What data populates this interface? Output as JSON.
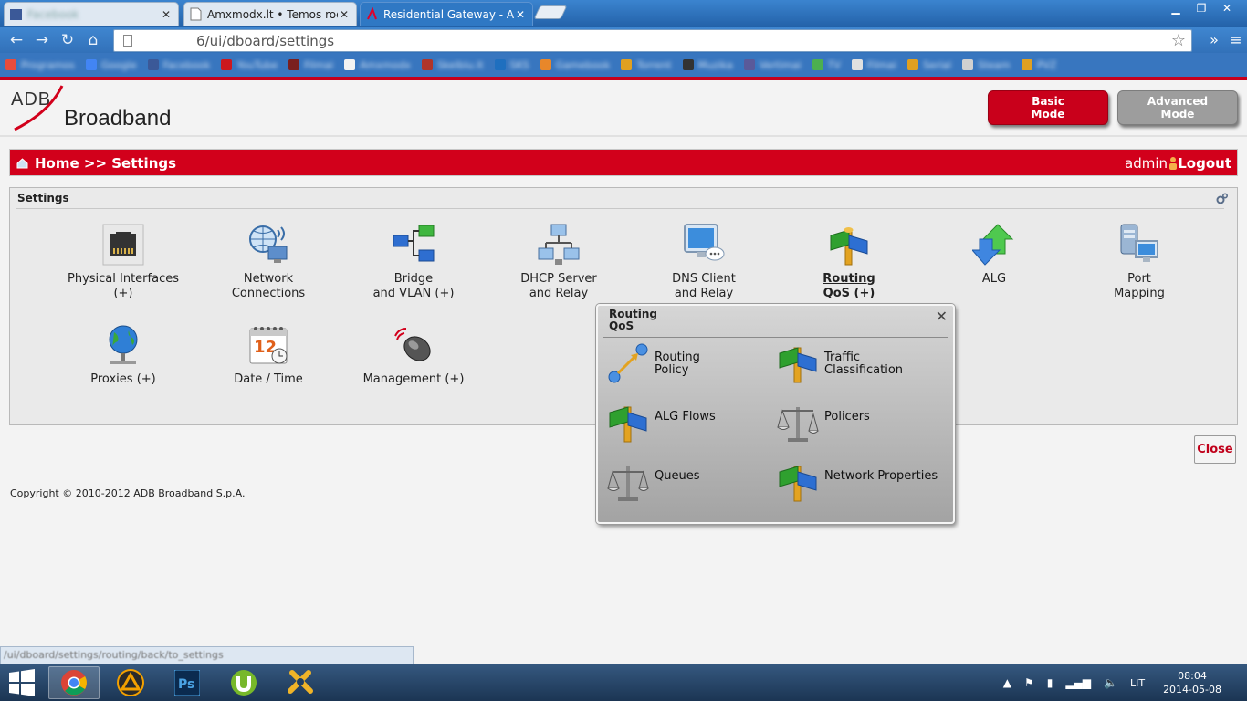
{
  "browser": {
    "tabs": [
      {
        "title": "Facebook",
        "blurred": true
      },
      {
        "title": "Amxmodx.lt • Temos rody",
        "blurred": false
      },
      {
        "title": "Residential Gateway - ADB",
        "blurred": false
      }
    ],
    "url": "6/ui/dboard/settings",
    "status_url": "/ui/dboard/settings/routing/back/to_settings",
    "bookmarks": [
      "Programos",
      "Google",
      "Facebook",
      "YouTube",
      "Filmai",
      "Amxmodx",
      "Skelbiu.lt",
      "SKS",
      "Gamebook",
      "Torrent",
      "Muzika",
      "Vertimai",
      "TV",
      "Filmai",
      "Serial",
      "Steam",
      "PVZ"
    ]
  },
  "header": {
    "logo_adb": "ADB",
    "logo_broadband": "Broadband",
    "basic_mode_line1": "Basic",
    "basic_mode_line2": "Mode",
    "advanced_mode_line1": "Advanced",
    "advanced_mode_line2": "Mode"
  },
  "crumbbar": {
    "path": "Home >> Settings",
    "user": "admin",
    "logout": "Logout"
  },
  "settings": {
    "title": "Settings",
    "items": [
      {
        "line1": "Physical Interfaces",
        "line2": "(+)",
        "icon": "ethernet-port-icon"
      },
      {
        "line1": "Network",
        "line2": "Connections",
        "icon": "globe-network-icon"
      },
      {
        "line1": "Bridge",
        "line2": "and VLAN (+)",
        "icon": "bridge-vlan-icon"
      },
      {
        "line1": "DHCP Server",
        "line2": "and Relay",
        "icon": "dhcp-server-icon"
      },
      {
        "line1": "DNS Client",
        "line2": "and Relay",
        "icon": "dns-client-icon"
      },
      {
        "line1": "Routing",
        "line2": "QoS (+)",
        "icon": "routing-signpost-icon"
      },
      {
        "line1": "ALG",
        "line2": "",
        "icon": "alg-arrows-icon"
      },
      {
        "line1": "Port",
        "line2": "Mapping",
        "icon": "port-mapping-icon"
      },
      {
        "line1": "Proxies (+)",
        "line2": "",
        "icon": "proxy-globe-icon"
      },
      {
        "line1": "Date / Time",
        "line2": "",
        "icon": "calendar-icon"
      },
      {
        "line1": "Management (+)",
        "line2": "",
        "icon": "mouse-remote-icon"
      }
    ]
  },
  "popup": {
    "title_line1": "Routing",
    "title_line2": "QoS",
    "items": [
      {
        "line1": "Routing",
        "line2": "Policy",
        "icon": "routing-policy-icon"
      },
      {
        "line1": "Traffic",
        "line2": "Classification",
        "icon": "signpost-icon"
      },
      {
        "line1": "ALG Flows",
        "line2": "",
        "icon": "signpost-icon"
      },
      {
        "line1": "Policers",
        "line2": "",
        "icon": "scales-icon"
      },
      {
        "line1": "Queues",
        "line2": "",
        "icon": "scales-icon"
      },
      {
        "line1": "Network Properties",
        "line2": "",
        "icon": "signpost-icon"
      }
    ]
  },
  "close_label": "Close",
  "copyright": "Copyright © 2010-2012 ADB Broadband S.p.A.",
  "taskbar": {
    "language": "LIT",
    "time": "08:04",
    "date": "2014-05-08"
  },
  "colors": {
    "brand_red": "#d2001b",
    "chrome_blue": "#3a7cc5",
    "taskbar": "#1f3f63"
  }
}
